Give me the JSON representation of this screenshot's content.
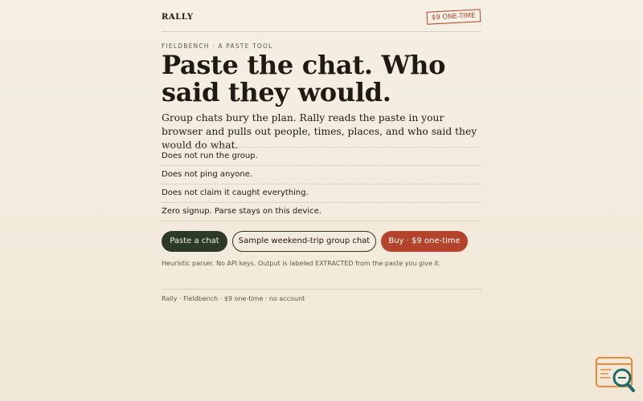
{
  "header": {
    "brand": "RALLY",
    "price_tag": "$9 ONE-TIME"
  },
  "hero": {
    "eyebrow": "FIELDBENCH · A PASTE TOOL",
    "headline_line1": "Paste the chat. Who",
    "headline_line2": "said they would.",
    "lede": "Group chats bury the plan. Rally reads the paste in your browser and pulls out people, times, places, and who said they would do what."
  },
  "not_list": [
    "Does not run the group.",
    "Does not ping anyone.",
    "Does not claim it caught everything.",
    "Zero signup. Parse stays on this device."
  ],
  "ctas": {
    "primary": "Paste a chat",
    "secondary": "Sample weekend-trip group chat",
    "buy": "Buy · $9 one-time"
  },
  "fineprint": "Heuristic parser. No API keys. Output is labeled EXTRACTED from the paste you give it.",
  "footer": "Rally · Fieldbench · $9 one-time · no account",
  "colors": {
    "background": "#f3ecdf",
    "ink": "#1f1a12",
    "accent_red": "#b3432a",
    "accent_green": "#2c3a27",
    "badge_orange": "#e88a3c",
    "badge_teal": "#1c6b6b"
  },
  "icons": {
    "corner_badge": "browser-window-magnifier-icon"
  }
}
